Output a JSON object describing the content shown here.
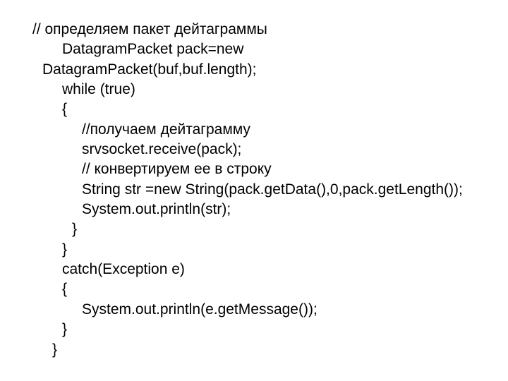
{
  "code": {
    "l1": "// определяем пакет дейтаграммы",
    "l2": "DatagramPacket pack=new",
    "l2b": "DatagramPacket(buf,buf.length);",
    "l3": "while (true)",
    "l4": "{",
    "l5": "//получаем дейтаграмму",
    "l6": "srvsocket.receive(pack);",
    "l7": "// конвертируем ее в строку",
    "l8": "String str =new String(pack.getData(),0,pack.getLength());",
    "l9": "System.out.println(str);",
    "l10": "}",
    "l11": "}",
    "l12": "catch(Exception e)",
    "l13": "{",
    "l14": "System.out.println(e.getMessage());",
    "l15": "}",
    "l16": "}"
  }
}
